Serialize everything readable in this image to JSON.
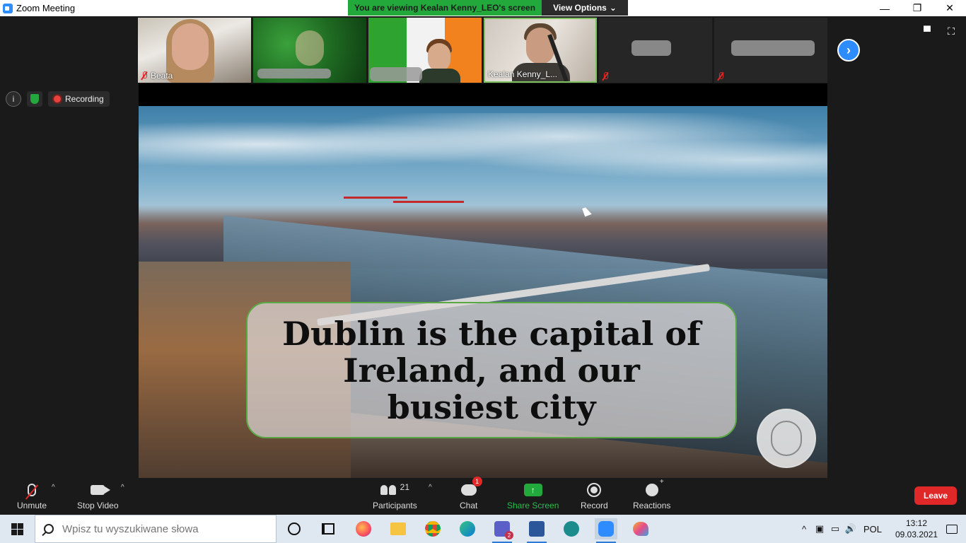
{
  "window": {
    "title": "Zoom Meeting",
    "minimize": "—",
    "restore": "❐",
    "close": "✕"
  },
  "banner": {
    "message": "You are viewing Kealan Kenny_LEO's screen",
    "options_label": "View Options",
    "options_caret": "⌄"
  },
  "participants": [
    {
      "name": "Beata",
      "muted": true
    },
    {
      "name": "",
      "muted": false
    },
    {
      "name": "",
      "muted": false
    },
    {
      "name": "Kealan Kenny_L...",
      "muted": false
    },
    {
      "name": "",
      "muted": true
    },
    {
      "name": "",
      "muted": true
    }
  ],
  "status": {
    "info_symbol": "i",
    "recording_label": "Recording"
  },
  "slide": {
    "caption": "Dublin is the capital of Ireland, and our busiest city"
  },
  "toolbar": {
    "unmute": "Unmute",
    "stop_video": "Stop Video",
    "participants_label": "Participants",
    "participants_count": "21",
    "chat": "Chat",
    "chat_badge": "1",
    "share_screen": "Share Screen",
    "share_arrow": "↑",
    "record": "Record",
    "reactions": "Reactions",
    "leave": "Leave",
    "caret": "^"
  },
  "taskbar": {
    "search_placeholder": "Wpisz tu wyszukiwane słowa",
    "language": "POL",
    "time": "13:12",
    "date": "09.03.2021",
    "tray_chevron": "^",
    "volume_glyph": "🔊"
  },
  "colors": {
    "zoom_blue": "#2d8cff",
    "share_green": "#23a83c",
    "leave_red": "#e02828"
  }
}
